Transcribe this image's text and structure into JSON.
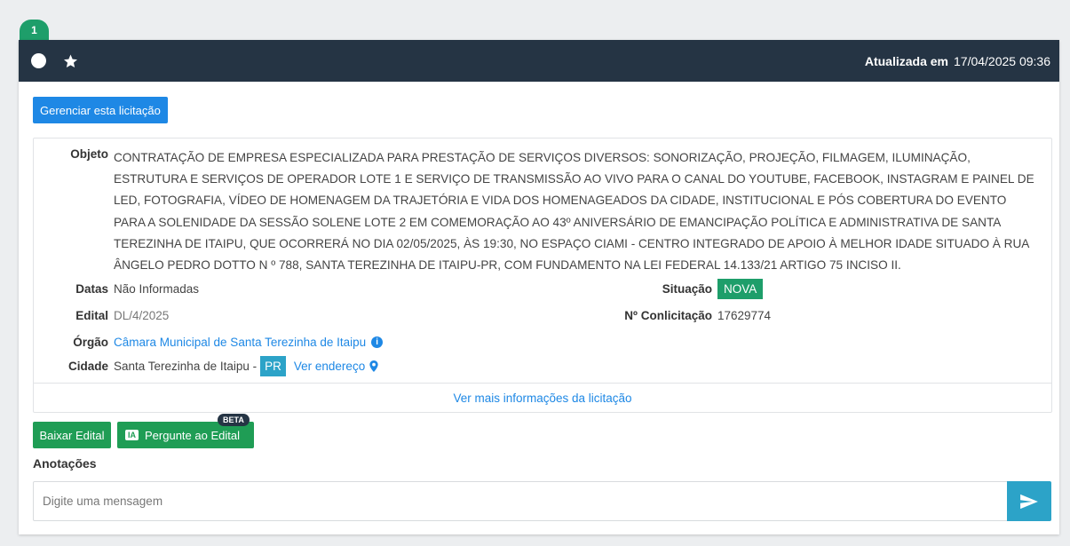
{
  "badge": {
    "number": "1"
  },
  "header": {
    "updated_label": "Atualizada em",
    "updated_value": "17/04/2025 09:36"
  },
  "actions": {
    "manage_label": "Gerenciar esta licitação"
  },
  "details": {
    "objeto_label": "Objeto",
    "objeto_lines": [
      "CONTRATAÇÃO DE EMPRESA ESPECIALIZADA PARA PRESTAÇÃO DE SERVIÇOS DIVERSOS: SONORIZAÇÃO, PROJEÇÃO, FILMAGEM, ILUMINAÇÃO,",
      "ESTRUTURA E SERVIÇOS DE OPERADOR LOTE 1 E SERVIÇO DE TRANSMISSÃO AO VIVO PARA O CANAL DO YOUTUBE, FACEBOOK, INSTAGRAM E PAINEL DE",
      "LED, FOTOGRAFIA, VÍDEO DE HOMENAGEM DA TRAJETÓRIA E VIDA DOS HOMENAGEADOS DA CIDADE, INSTITUCIONAL E PÓS COBERTURA DO EVENTO",
      "PARA A SOLENIDADE DA SESSÃO SOLENE LOTE 2 EM COMEMORAÇÃO AO 43º ANIVERSÁRIO DE EMANCIPAÇÃO POLÍTICA E ADMINISTRATIVA DE SANTA",
      "TEREZINHA DE ITAIPU, QUE OCORRERÁ NO DIA 02/05/2025, ÀS 19:30, NO ESPAÇO CIAMI - CENTRO INTEGRADO DE APOIO À MELHOR IDADE SITUADO À RUA",
      "ÂNGELO PEDRO DOTTO N º 788, SANTA TEREZINHA DE ITAIPU-PR, COM FUNDAMENTO NA LEI FEDERAL 14.133/21 ARTIGO 75 INCISO II."
    ],
    "datas_label": "Datas",
    "datas_value": "Não Informadas",
    "edital_label": "Edital",
    "edital_value": "DL/4/2025",
    "orgao_label": "Órgão",
    "orgao_value": "Câmara Municipal de Santa Terezinha de Itaipu",
    "cidade_label": "Cidade",
    "cidade_value": "Santa Terezinha de Itaipu -",
    "uf": "PR",
    "endereco_link": "Ver endereço",
    "situacao_label": "Situação",
    "situacao_value": "NOVA",
    "conlicitacao_label": "Nº Conlicitação",
    "conlicitacao_value": "17629774",
    "more_info_link": "Ver mais informações da licitação"
  },
  "buttons": {
    "baixar_label": "Baixar Edital",
    "ia_badge": "IA",
    "pergunte_label": "Pergunte ao Edital",
    "beta_label": "BETA"
  },
  "notes": {
    "title": "Anotações",
    "placeholder": "Digite uma mensagem"
  },
  "colors": {
    "header_bg": "#253444",
    "primary": "#1e88e5",
    "success": "#1f9d55",
    "info": "#2ca3c8"
  }
}
